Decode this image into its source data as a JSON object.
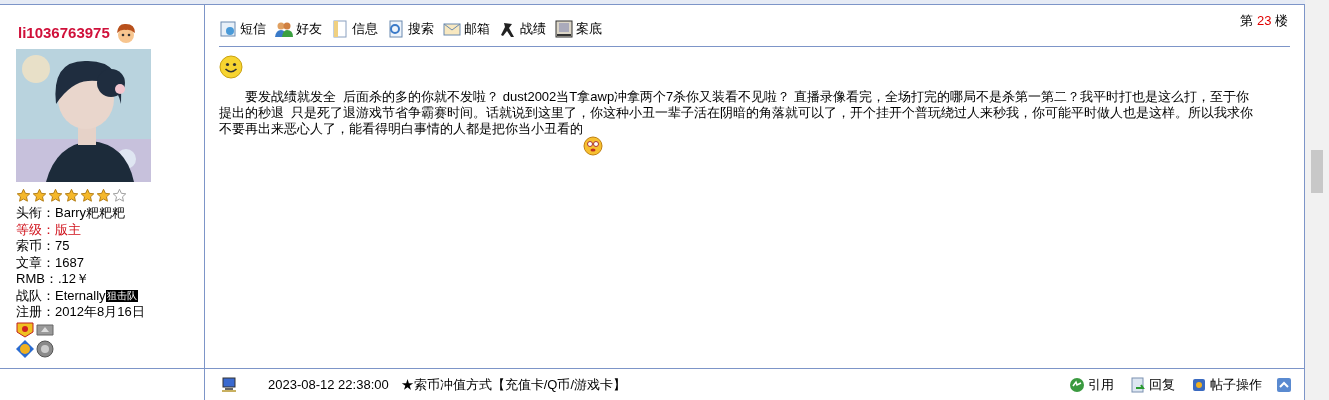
{
  "author": {
    "username": "li1036763975",
    "stars": 6,
    "fields": [
      {
        "label": "头衔：",
        "value": "Barry粑粑粑",
        "highlight": false
      },
      {
        "label": "等级：",
        "value": "版主",
        "highlight": true
      },
      {
        "label": "索币：",
        "value": "75",
        "highlight": false
      },
      {
        "label": "文章：",
        "value": "1687",
        "highlight": false
      },
      {
        "label": "RMB：",
        "value": ".12￥",
        "highlight": false
      },
      {
        "label": "战队：",
        "value": "Eternally",
        "badge": "狙击队",
        "highlight": false
      },
      {
        "label": "注册：",
        "value": "2012年8月16日",
        "highlight": false
      }
    ]
  },
  "toolbar": [
    "短信",
    "好友",
    "信息",
    "搜索",
    "邮箱",
    "战绩",
    "案底"
  ],
  "floor": {
    "prefix": "第",
    "number": "23",
    "suffix": "楼"
  },
  "post": {
    "text": "　　要发战绩就发全  后面杀的多的你就不发啦？ dust2002当T拿awp冲拿两个7杀你又装看不见啦？ 直播录像看完，全场打完的哪局不是杀第一第二？我平时打也是这么打，至于你提出的秒退  只是死了退游戏节省争霸赛时间。话就说到这里了，你这种小丑一辈子活在阴暗的角落就可以了，开个挂开个普玩绕过人来秒我，你可能平时做人也是这样。所以我求你不要再出来恶心人了，能看得明白事情的人都是把你当小丑看的"
  },
  "footer": {
    "time": "2023-08-12 22:38:00",
    "promo": "★索币冲值方式【充值卡/Q币/游戏卡】",
    "actions": [
      "引用",
      "回复",
      "帖子操作"
    ]
  }
}
